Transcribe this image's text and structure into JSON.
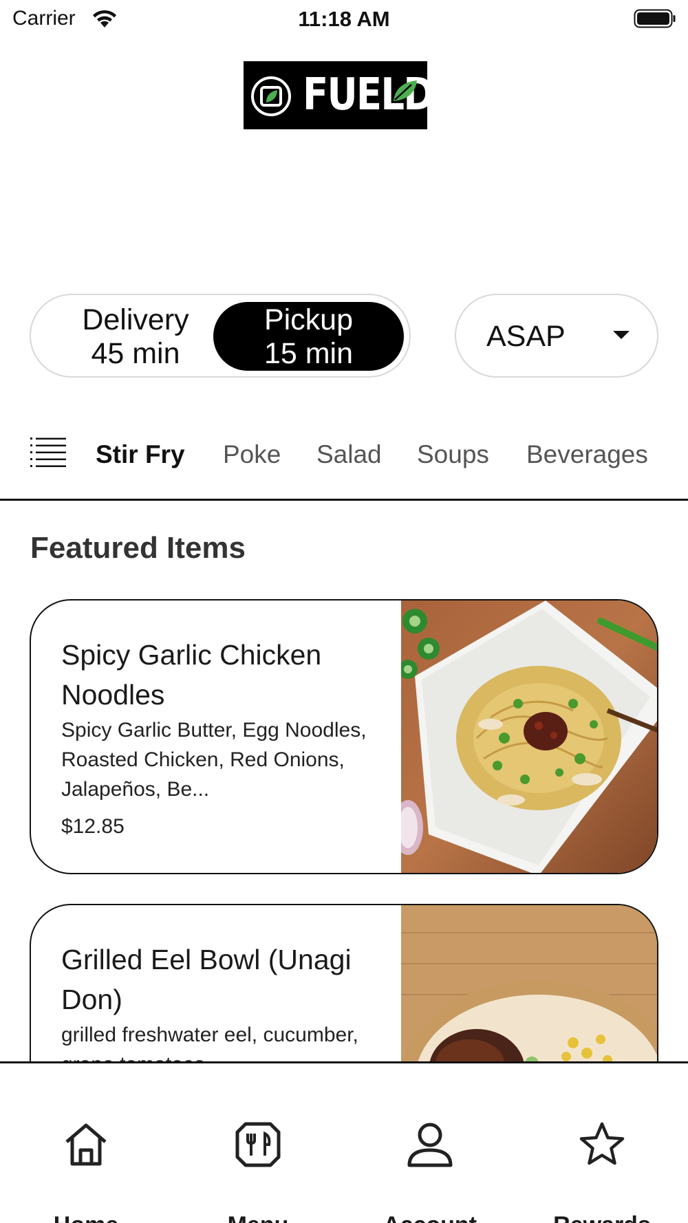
{
  "status_bar": {
    "carrier": "Carrier",
    "time": "11:18 AM",
    "icons": [
      "wifi-icon",
      "battery-icon"
    ]
  },
  "brand": {
    "logo_text": "FUEL",
    "logo_text_tail": "D",
    "accent": "#4caf50"
  },
  "order_mode": {
    "delivery": {
      "label": "Delivery",
      "time": "45 min"
    },
    "pickup": {
      "label": "Pickup",
      "time": "15 min"
    },
    "selected": "pickup"
  },
  "time_select": {
    "value": "ASAP",
    "icon": "chevron-down-icon"
  },
  "categories": {
    "icon": "list-icon",
    "items": [
      "Stir Fry",
      "Poke",
      "Salad",
      "Soups",
      "Beverages"
    ],
    "active": "Stir Fry"
  },
  "featured": {
    "title": "Featured Items",
    "items": [
      {
        "title": "Spicy Garlic Chicken Noodles",
        "description": "Spicy Garlic Butter, Egg Noodles, Roasted Chicken, Red Onions, Jalapeños, Be...",
        "price": "$12.85",
        "image": "noodles-photo"
      },
      {
        "title": "Grilled Eel Bowl (Unagi Don)",
        "description": "grilled freshwater eel, cucumber, grape tomatoes,",
        "price": "",
        "image": "eel-bowl-photo"
      }
    ]
  },
  "tab_bar": {
    "tabs": [
      {
        "label": "Home",
        "icon": "home-icon"
      },
      {
        "label": "Menu",
        "icon": "menu-icon"
      },
      {
        "label": "Account",
        "icon": "account-icon"
      },
      {
        "label": "Rewards",
        "icon": "star-icon"
      }
    ]
  }
}
